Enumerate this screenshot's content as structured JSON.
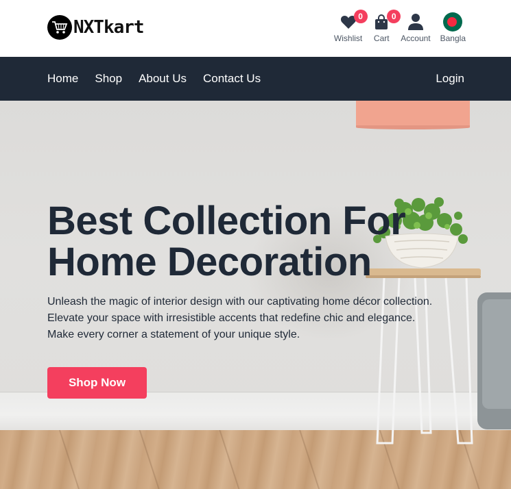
{
  "brand": {
    "name": "NXTkart"
  },
  "header": {
    "actions": [
      {
        "icon": "heart-icon",
        "label": "Wishlist",
        "badge": "0"
      },
      {
        "icon": "shopping-bag-icon",
        "label": "Cart",
        "badge": "0"
      },
      {
        "icon": "user-icon",
        "label": "Account"
      },
      {
        "icon": "bangladesh-flag-icon",
        "label": "Bangla"
      }
    ]
  },
  "nav": {
    "links": [
      "Home",
      "Shop",
      "About Us",
      "Contact Us"
    ],
    "login": "Login"
  },
  "hero": {
    "title_line1": "Best Collection For",
    "title_line2": "Home Decoration",
    "description_line1": "Unleash the magic of interior design with our captivating home décor collection.",
    "description_line2": "Elevate your space with irresistible accents that redefine chic and elegance.",
    "description_line3": "Make every corner a statement of your unique style.",
    "cta": "Shop Now"
  },
  "colors": {
    "primary": "#f43f5e",
    "nav_bg": "#1f2937",
    "text_dark": "#1f2937"
  }
}
